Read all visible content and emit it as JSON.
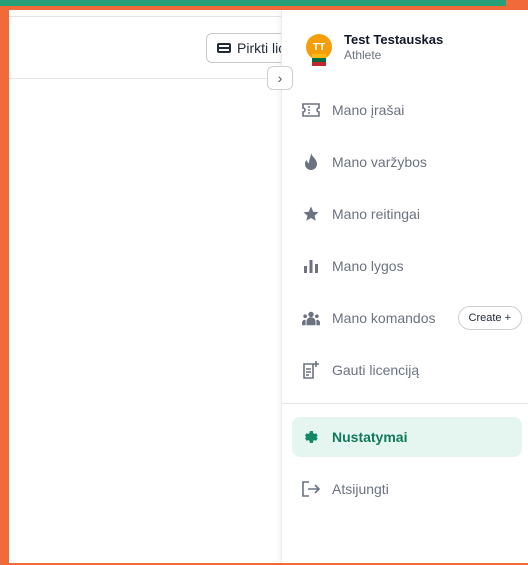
{
  "topbar": {
    "license_button_label": "Pirkti lic"
  },
  "profile": {
    "initials": "TT",
    "name": "Test Testauskas",
    "role": "Athlete"
  },
  "menu": {
    "items": [
      {
        "label": "Mano įrašai",
        "icon": "ticket-icon"
      },
      {
        "label": "Mano varžybos",
        "icon": "fire-icon"
      },
      {
        "label": "Mano reitingai",
        "icon": "star-icon"
      },
      {
        "label": "Mano lygos",
        "icon": "bar-chart-icon"
      },
      {
        "label": "Mano komandos",
        "icon": "team-icon"
      },
      {
        "label": "Gauti licenciją",
        "icon": "document-add-icon"
      }
    ],
    "create_label": "Create +",
    "settings_label": "Nustatymai",
    "logout_label": "Atsijungti"
  },
  "colors": {
    "accent": "#0f8a63",
    "active_bg": "#e5f6f1",
    "avatar": "#f59e0b",
    "border_outer": "#f06a3a"
  }
}
